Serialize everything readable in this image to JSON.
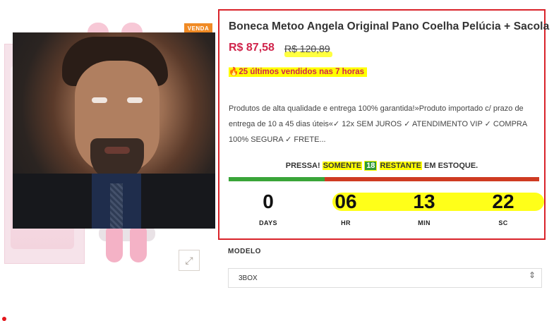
{
  "gallery": {
    "sale_badge": "VENDA",
    "expand_icon": "expand-icon",
    "expand_glyph": "⤢"
  },
  "product": {
    "title": "Boneca Metoo Angela Original Pano Coelha Pelúcia + Sacola",
    "price": "R$ 87,58",
    "old_price": "R$ 120,89",
    "sold_icon": "fire-icon",
    "sold_text": "25 últimos vendidos nas 7 horas",
    "description": "Produtos de alta qualidade e entrega 100% garantida!»Produto importado c/ prazo de entrega de 10 a 45 dias úteis«✓ 12x SEM JUROS ✓ ATENDIMENTO VIP ✓ COMPRA 100% SEGURA ✓ FRETE..."
  },
  "stock": {
    "prefix": "PRESSA!",
    "somente": "SOMENTE",
    "count": "18",
    "restante": "RESTANTE",
    "suffix": "EM ESTOQUE.",
    "progress_fraction": 0.31
  },
  "countdown": [
    {
      "value": "0",
      "label": "DAYS"
    },
    {
      "value": "06",
      "label": "HR"
    },
    {
      "value": "13",
      "label": "MIN"
    },
    {
      "value": "22",
      "label": "SC"
    }
  ],
  "variant": {
    "label": "MODELO",
    "selected": "3BOX"
  },
  "colors": {
    "border_red": "#d9232a",
    "price_pink": "#d0244b",
    "highlight_yellow": "#ffff00",
    "progress_green": "#3aa539",
    "progress_red": "#cf3b22",
    "badge_orange": "#f08a24"
  }
}
